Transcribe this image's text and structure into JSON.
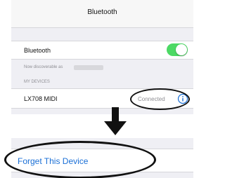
{
  "header": {
    "title": "Bluetooth"
  },
  "bluetooth_toggle": {
    "label": "Bluetooth",
    "state": "on",
    "color": "#4cd964"
  },
  "discoverable": {
    "text": "Now discoverable as"
  },
  "my_devices": {
    "header": "MY DEVICES",
    "devices": [
      {
        "name": "LX708 MIDI",
        "status": "Connected",
        "info_icon": "info-icon"
      }
    ]
  },
  "annotation": {
    "arrow_icon": "down-arrow-icon"
  },
  "action": {
    "forget_label": "Forget This Device",
    "color": "#1a6fd6"
  }
}
